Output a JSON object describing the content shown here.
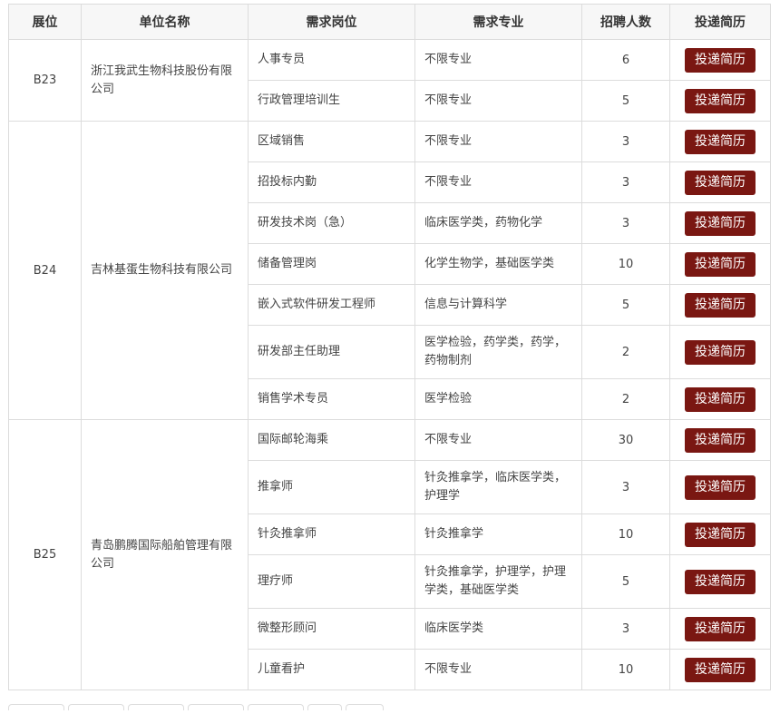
{
  "headers": {
    "booth": "展位",
    "company": "单位名称",
    "position": "需求岗位",
    "major": "需求专业",
    "count": "招聘人数",
    "apply": "投递简历"
  },
  "apply_label": "投递简历",
  "accent_color": "#7a1712",
  "groups": [
    {
      "booth": "B23",
      "company": "浙江我武生物科技股份有限公司",
      "rows": [
        {
          "position": "人事专员",
          "major": "不限专业",
          "count": "6"
        },
        {
          "position": "行政管理培训生",
          "major": "不限专业",
          "count": "5"
        }
      ]
    },
    {
      "booth": "B24",
      "company": "吉林基蛋生物科技有限公司",
      "rows": [
        {
          "position": "区域销售",
          "major": "不限专业",
          "count": "3"
        },
        {
          "position": "招投标内勤",
          "major": "不限专业",
          "count": "3"
        },
        {
          "position": "研发技术岗（急）",
          "major": "临床医学类，药物化学",
          "count": "3"
        },
        {
          "position": "储备管理岗",
          "major": "化学生物学，基础医学类",
          "count": "10"
        },
        {
          "position": "嵌入式软件研发工程师",
          "major": "信息与计算科学",
          "count": "5"
        },
        {
          "position": "研发部主任助理",
          "major": "医学检验，药学类，药学，药物制剂",
          "count": "2"
        },
        {
          "position": "销售学术专员",
          "major": "医学检验",
          "count": "2"
        }
      ]
    },
    {
      "booth": "B25",
      "company": "青岛鹏腾国际船舶管理有限公司",
      "rows": [
        {
          "position": "国际邮轮海乘",
          "major": "不限专业",
          "count": "30"
        },
        {
          "position": "推拿师",
          "major": "针灸推拿学，临床医学类，护理学",
          "count": "3"
        },
        {
          "position": "针灸推拿师",
          "major": "针灸推拿学",
          "count": "10"
        },
        {
          "position": "理疗师",
          "major": "针灸推拿学，护理学，护理学类，基础医学类",
          "count": "5"
        },
        {
          "position": "微整形顾问",
          "major": "临床医学类",
          "count": "3"
        },
        {
          "position": "儿童看护",
          "major": "不限专业",
          "count": "10"
        }
      ]
    }
  ]
}
